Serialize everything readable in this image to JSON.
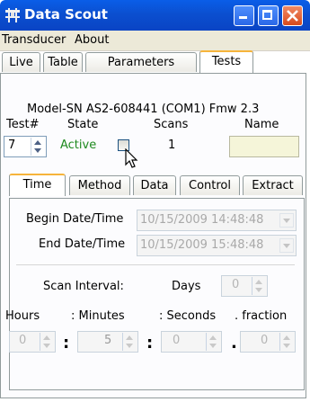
{
  "window": {
    "title": "Data Scout",
    "buttons": {
      "minimize": "minimize",
      "maximize": "maximize",
      "close": "close"
    }
  },
  "menu": [
    "Transducer",
    "About"
  ],
  "main_tabs": [
    {
      "label": "Live",
      "active": false
    },
    {
      "label": "Table",
      "active": false
    },
    {
      "label": "Parameters",
      "active": false
    },
    {
      "label": "Tests",
      "active": true
    }
  ],
  "device_info": "Model-SN AS2-608441 (COM1) Fmw 2.3",
  "test_header": {
    "test": "Test#",
    "state": "State",
    "scans": "Scans",
    "name": "Name"
  },
  "test_row": {
    "test_number": "7",
    "state": "Active",
    "state_color": "#1e8a1e",
    "scans": "1",
    "name": ""
  },
  "sub_tabs": [
    {
      "label": "Time",
      "active": true
    },
    {
      "label": "Method",
      "active": false
    },
    {
      "label": "Data",
      "active": false
    },
    {
      "label": "Control",
      "active": false
    },
    {
      "label": "Extract",
      "active": false
    }
  ],
  "time": {
    "begin_label": "Begin Date/Time",
    "begin_value": "10/15/2009 14:48:48",
    "end_label": "End Date/Time",
    "end_value": "10/15/2009 15:48:48",
    "scan_interval_label": "Scan Interval:",
    "days_label": "Days",
    "days_value": "0",
    "hours_label": "Hours",
    "minutes_label": ": Minutes",
    "seconds_label": ": Seconds",
    "fraction_label": ". fraction",
    "hours_value": "0",
    "minutes_value": "5",
    "seconds_value": "0",
    "fraction_value": "0",
    "sep_colon": ":",
    "sep_dot": "."
  },
  "colors": {
    "titlebar": "#0b4fd0",
    "active_tab_accent": "#f6b43b",
    "name_field": "#f5f5d9"
  }
}
